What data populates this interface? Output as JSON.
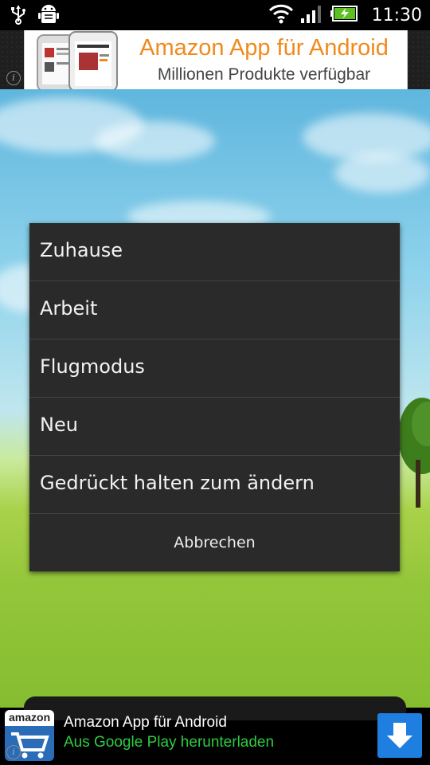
{
  "status_bar": {
    "time": "11:30",
    "icons": [
      "usb-icon",
      "android-debug-icon",
      "wifi-icon",
      "signal-icon",
      "battery-charging-icon"
    ]
  },
  "top_ad": {
    "title": "Amazon App für Android",
    "subtitle": "Millionen Produkte verfügbar",
    "info_glyph": "i"
  },
  "dialog": {
    "items": [
      {
        "label": "Zuhause"
      },
      {
        "label": "Arbeit"
      },
      {
        "label": "Flugmodus"
      },
      {
        "label": "Neu"
      },
      {
        "label": "Gedrückt halten zum ändern"
      }
    ],
    "cancel_label": "Abbrechen"
  },
  "bottom_ad": {
    "logo_text": "amazon",
    "title": "Amazon App für Android",
    "subtitle": "Aus Google Play herunterladen",
    "info_glyph": "i",
    "accent_color": "#2ecc40",
    "button_color": "#1e7fe0"
  }
}
